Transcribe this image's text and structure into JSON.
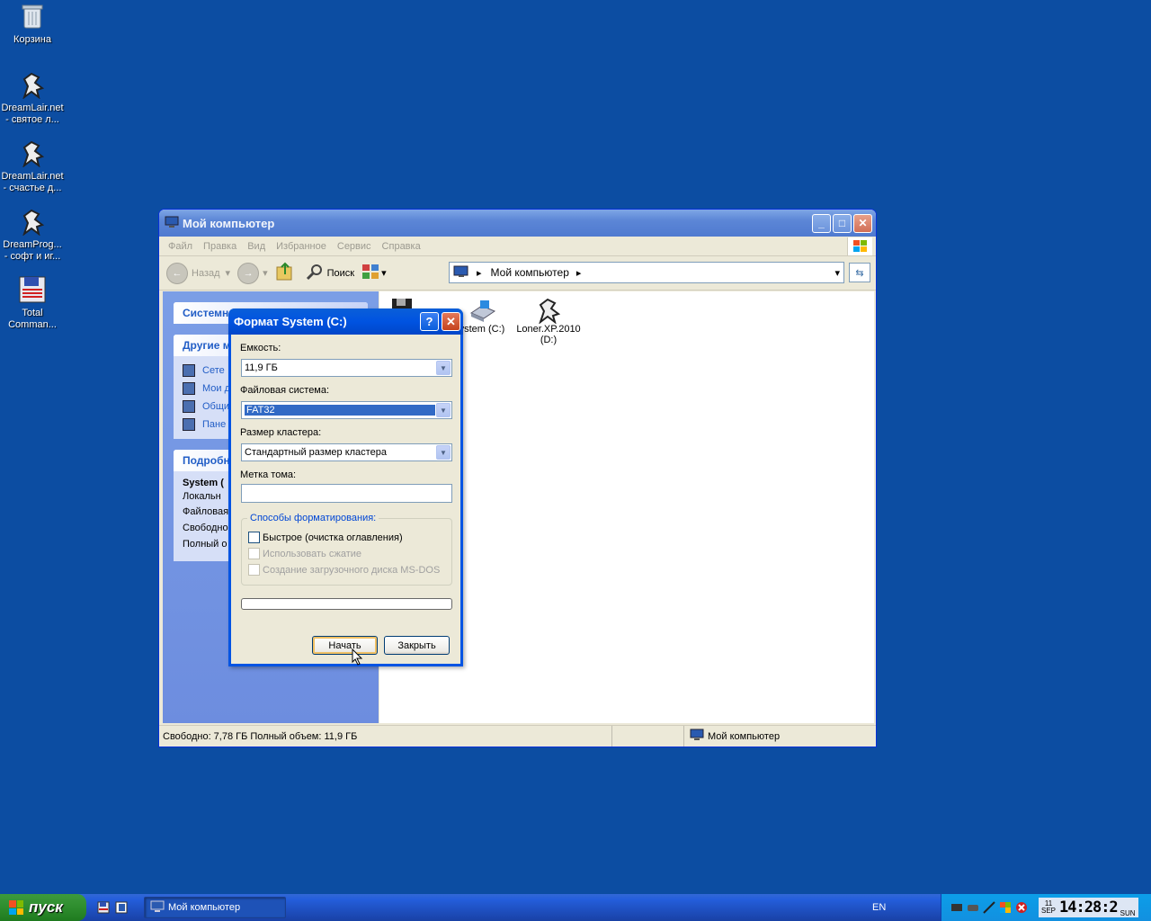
{
  "desktop": {
    "icons": [
      {
        "label": "Корзина"
      },
      {
        "label": "DreamLair.net - святое л..."
      },
      {
        "label": "DreamLair.net - счастье д..."
      },
      {
        "label": "DreamProg... - софт и иг..."
      },
      {
        "label": "Total Comman..."
      }
    ]
  },
  "explorer": {
    "title": "Мой компьютер",
    "menu": [
      "Файл",
      "Правка",
      "Вид",
      "Избранное",
      "Сервис",
      "Справка"
    ],
    "toolbar": {
      "back": "Назад",
      "search": "Поиск"
    },
    "address": "Мой компьютер",
    "taskpane": {
      "system_head": "Системн",
      "other_head": "Другие м",
      "other_items": [
        "Сете",
        "Мои д",
        "Общи",
        "Пане"
      ],
      "details_head": "Подробн",
      "details_lines": [
        "System (",
        "Локальн",
        "Файловая",
        "Свободно",
        "Полный о"
      ]
    },
    "drives": [
      {
        "label": "ystem (C:)"
      },
      {
        "label": "Loner.XP.2010 (D:)"
      }
    ],
    "status": {
      "left": "Свободно: 7,78 ГБ Полный объем: 11,9 ГБ",
      "right": "Мой компьютер"
    }
  },
  "format_dialog": {
    "title": "Формат System (C:)",
    "help": "?",
    "capacity_label": "Емкость:",
    "capacity_value": "11,9 ГБ",
    "fs_label": "Файловая система:",
    "fs_value": "FAT32",
    "cluster_label": "Размер кластера:",
    "cluster_value": "Стандартный размер кластера",
    "volume_label": "Метка тома:",
    "volume_value": "",
    "options_label": "Способы форматирования:",
    "options": [
      {
        "label": "Быстрое (очистка оглавления)",
        "enabled": true,
        "checked": false
      },
      {
        "label": "Использовать сжатие",
        "enabled": false,
        "checked": false
      },
      {
        "label": "Создание загрузочного диска MS-DOS",
        "enabled": false,
        "checked": false
      }
    ],
    "progress": 0,
    "start_button": "Начать",
    "close_button": "Закрыть"
  },
  "taskbar": {
    "start_label": "пуск",
    "task_label": "Мой компьютер",
    "language": "EN",
    "clock": {
      "day": "11",
      "month": "SEP",
      "time": "14:28:2",
      "weekday": "SUN"
    }
  }
}
